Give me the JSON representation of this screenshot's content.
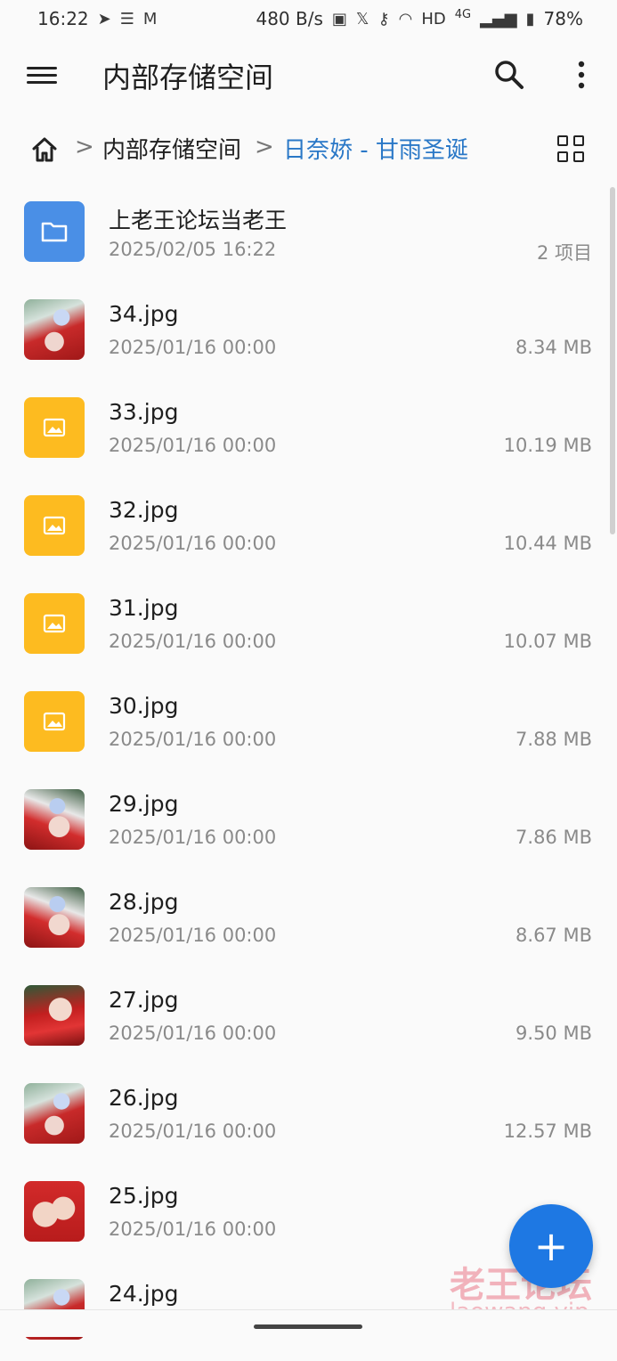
{
  "status_bar": {
    "time": "16:22",
    "net_speed": "480 B/s",
    "signal_label": "HD",
    "network_type": "4G",
    "battery": "78%"
  },
  "appbar": {
    "title": "内部存储空间"
  },
  "breadcrumb": {
    "items": [
      "内部存储空间",
      "日奈娇 - 甘雨圣诞"
    ],
    "separator": ">"
  },
  "files": [
    {
      "name": "上老王论坛当老王",
      "date": "2025/02/05 16:22",
      "meta": "2 项目",
      "kind": "folder-icon"
    },
    {
      "name": "34.jpg",
      "date": "2025/01/16 00:00",
      "meta": "8.34 MB",
      "kind": "photo-thumbnail"
    },
    {
      "name": "33.jpg",
      "date": "2025/01/16 00:00",
      "meta": "10.19 MB",
      "kind": "image-icon"
    },
    {
      "name": "32.jpg",
      "date": "2025/01/16 00:00",
      "meta": "10.44 MB",
      "kind": "image-icon"
    },
    {
      "name": "31.jpg",
      "date": "2025/01/16 00:00",
      "meta": "10.07 MB",
      "kind": "image-icon"
    },
    {
      "name": "30.jpg",
      "date": "2025/01/16 00:00",
      "meta": "7.88 MB",
      "kind": "image-icon"
    },
    {
      "name": "29.jpg",
      "date": "2025/01/16 00:00",
      "meta": "7.86 MB",
      "kind": "photo-thumbnail"
    },
    {
      "name": "28.jpg",
      "date": "2025/01/16 00:00",
      "meta": "8.67 MB",
      "kind": "photo-thumbnail"
    },
    {
      "name": "27.jpg",
      "date": "2025/01/16 00:00",
      "meta": "9.50 MB",
      "kind": "photo-thumbnail"
    },
    {
      "name": "26.jpg",
      "date": "2025/01/16 00:00",
      "meta": "12.57 MB",
      "kind": "photo-thumbnail"
    },
    {
      "name": "25.jpg",
      "date": "2025/01/16 00:00",
      "meta": "",
      "kind": "photo-thumbnail"
    },
    {
      "name": "24.jpg",
      "date": "",
      "meta": "",
      "kind": "photo-thumbnail"
    }
  ],
  "fab": {
    "label": "+"
  },
  "watermark": {
    "text": "老王论坛",
    "url": "laowang.vip"
  },
  "colors": {
    "accent": "#1e78e3",
    "breadcrumb_current": "#2a78c7",
    "folder": "#4a8fe6",
    "image_placeholder": "#fdbb20"
  }
}
